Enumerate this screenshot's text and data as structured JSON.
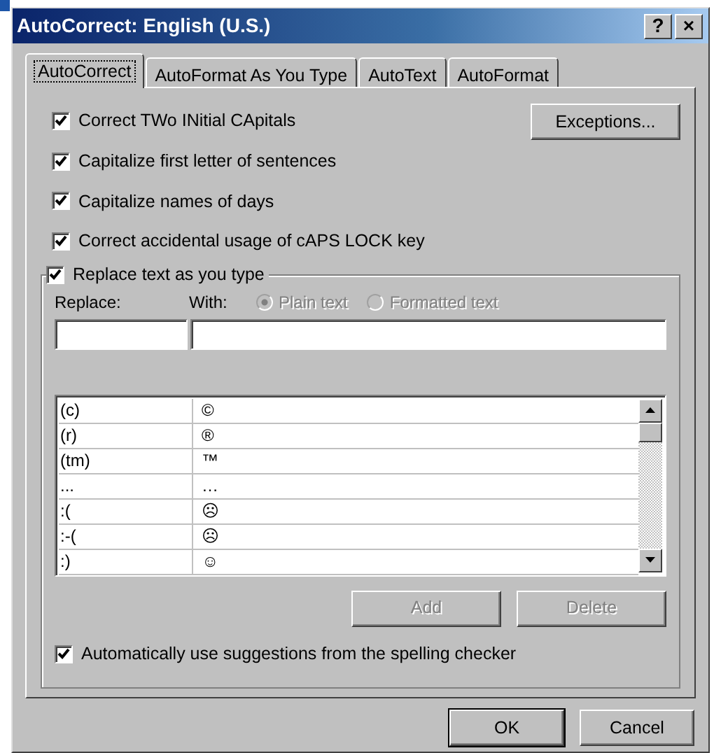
{
  "window": {
    "title": "AutoCorrect: English (U.S.)",
    "title_buttons": [
      {
        "kind": "help",
        "label": "?"
      },
      {
        "kind": "close",
        "label": "×"
      }
    ]
  },
  "tabs": [
    {
      "label": "AutoCorrect",
      "selected": true
    },
    {
      "label": "AutoFormat As You Type",
      "selected": false
    },
    {
      "label": "AutoText",
      "selected": false
    },
    {
      "label": "AutoFormat",
      "selected": false
    }
  ],
  "options": [
    {
      "label": "Correct TWo INitial CApitals",
      "checked": true
    },
    {
      "label": "Capitalize first letter of sentences",
      "checked": true
    },
    {
      "label": "Capitalize names of days",
      "checked": true
    },
    {
      "label": "Correct accidental usage of cAPS LOCK key",
      "checked": true
    }
  ],
  "exceptions_button": "Exceptions...",
  "replace_group": {
    "label": "Replace text as you type",
    "checked": true,
    "replace_label": "Replace:",
    "with_label": "With:",
    "format_options": [
      {
        "label": "Plain text",
        "selected": true,
        "disabled": true
      },
      {
        "label": "Formatted text",
        "selected": false,
        "disabled": true
      }
    ],
    "entries": [
      {
        "replace": "(c)",
        "with": "©"
      },
      {
        "replace": "(r)",
        "with": "®"
      },
      {
        "replace": "(tm)",
        "with": "™"
      },
      {
        "replace": "...",
        "with": "…"
      },
      {
        "replace": ":(",
        "with": "☹"
      },
      {
        "replace": ":-(",
        "with": "☹"
      },
      {
        "replace": ":)",
        "with": "☺"
      }
    ],
    "buttons": [
      {
        "label": "Add",
        "disabled": true
      },
      {
        "label": "Delete",
        "disabled": true
      }
    ],
    "suggestions": {
      "label": "Automatically use suggestions from the spelling checker",
      "checked": true
    }
  },
  "footer_buttons": [
    {
      "label": "OK",
      "default": true
    },
    {
      "label": "Cancel",
      "default": false
    }
  ]
}
